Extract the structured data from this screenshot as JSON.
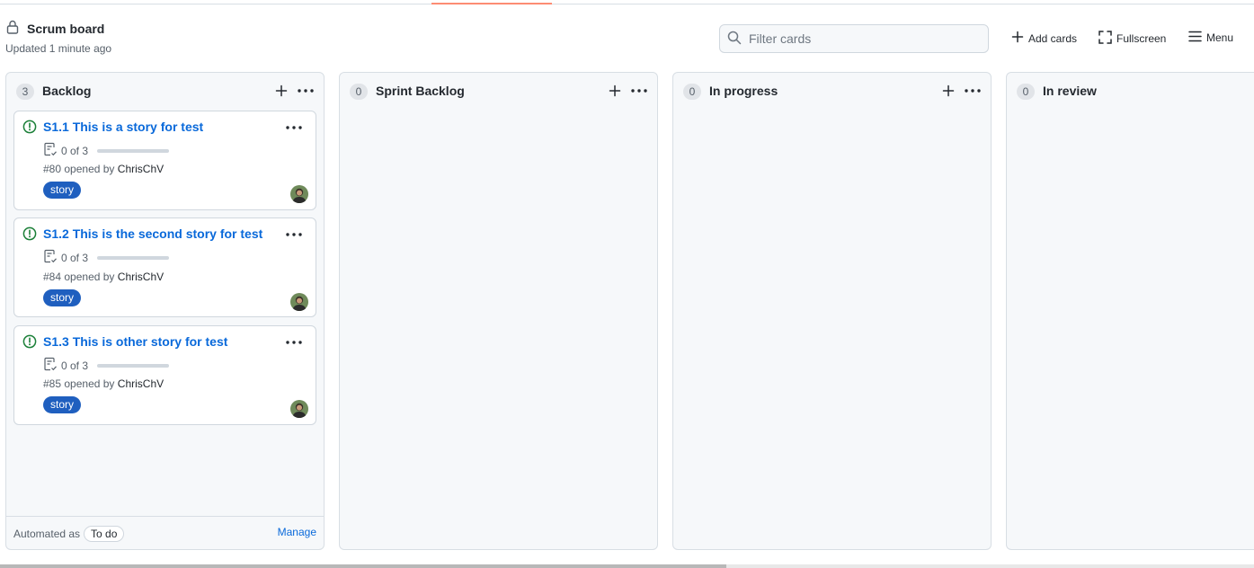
{
  "header": {
    "title": "Scrum board",
    "updated": "Updated 1 minute ago",
    "filter_placeholder": "Filter cards",
    "add_cards": "Add cards",
    "fullscreen": "Fullscreen",
    "menu": "Menu"
  },
  "columns": [
    {
      "count": "3",
      "title": "Backlog",
      "cards": [
        {
          "title": "S1.1 This is a story for test",
          "tasks": "0 of 3",
          "tasks_done": 0,
          "number": "#80",
          "opened_by": "opened by",
          "author": "ChrisChV",
          "label": "story"
        },
        {
          "title": "S1.2 This is the second story for test",
          "tasks": "0 of 3",
          "tasks_done": 0,
          "number": "#84",
          "opened_by": "opened by",
          "author": "ChrisChV",
          "label": "story"
        },
        {
          "title": "S1.3 This is other story for test",
          "tasks": "0 of 3",
          "tasks_done": 0,
          "number": "#85",
          "opened_by": "opened by",
          "author": "ChrisChV",
          "label": "story"
        }
      ],
      "footer": {
        "automated_as": "Automated as",
        "automation": "To do",
        "manage": "Manage"
      }
    },
    {
      "count": "0",
      "title": "Sprint Backlog"
    },
    {
      "count": "0",
      "title": "In progress"
    },
    {
      "count": "0",
      "title": "In review"
    }
  ],
  "colors": {
    "accent": "#0969da",
    "label_bg": "#1f5fbf",
    "open_issue": "#1a7f37",
    "tab_underline": "#fd8c73"
  }
}
